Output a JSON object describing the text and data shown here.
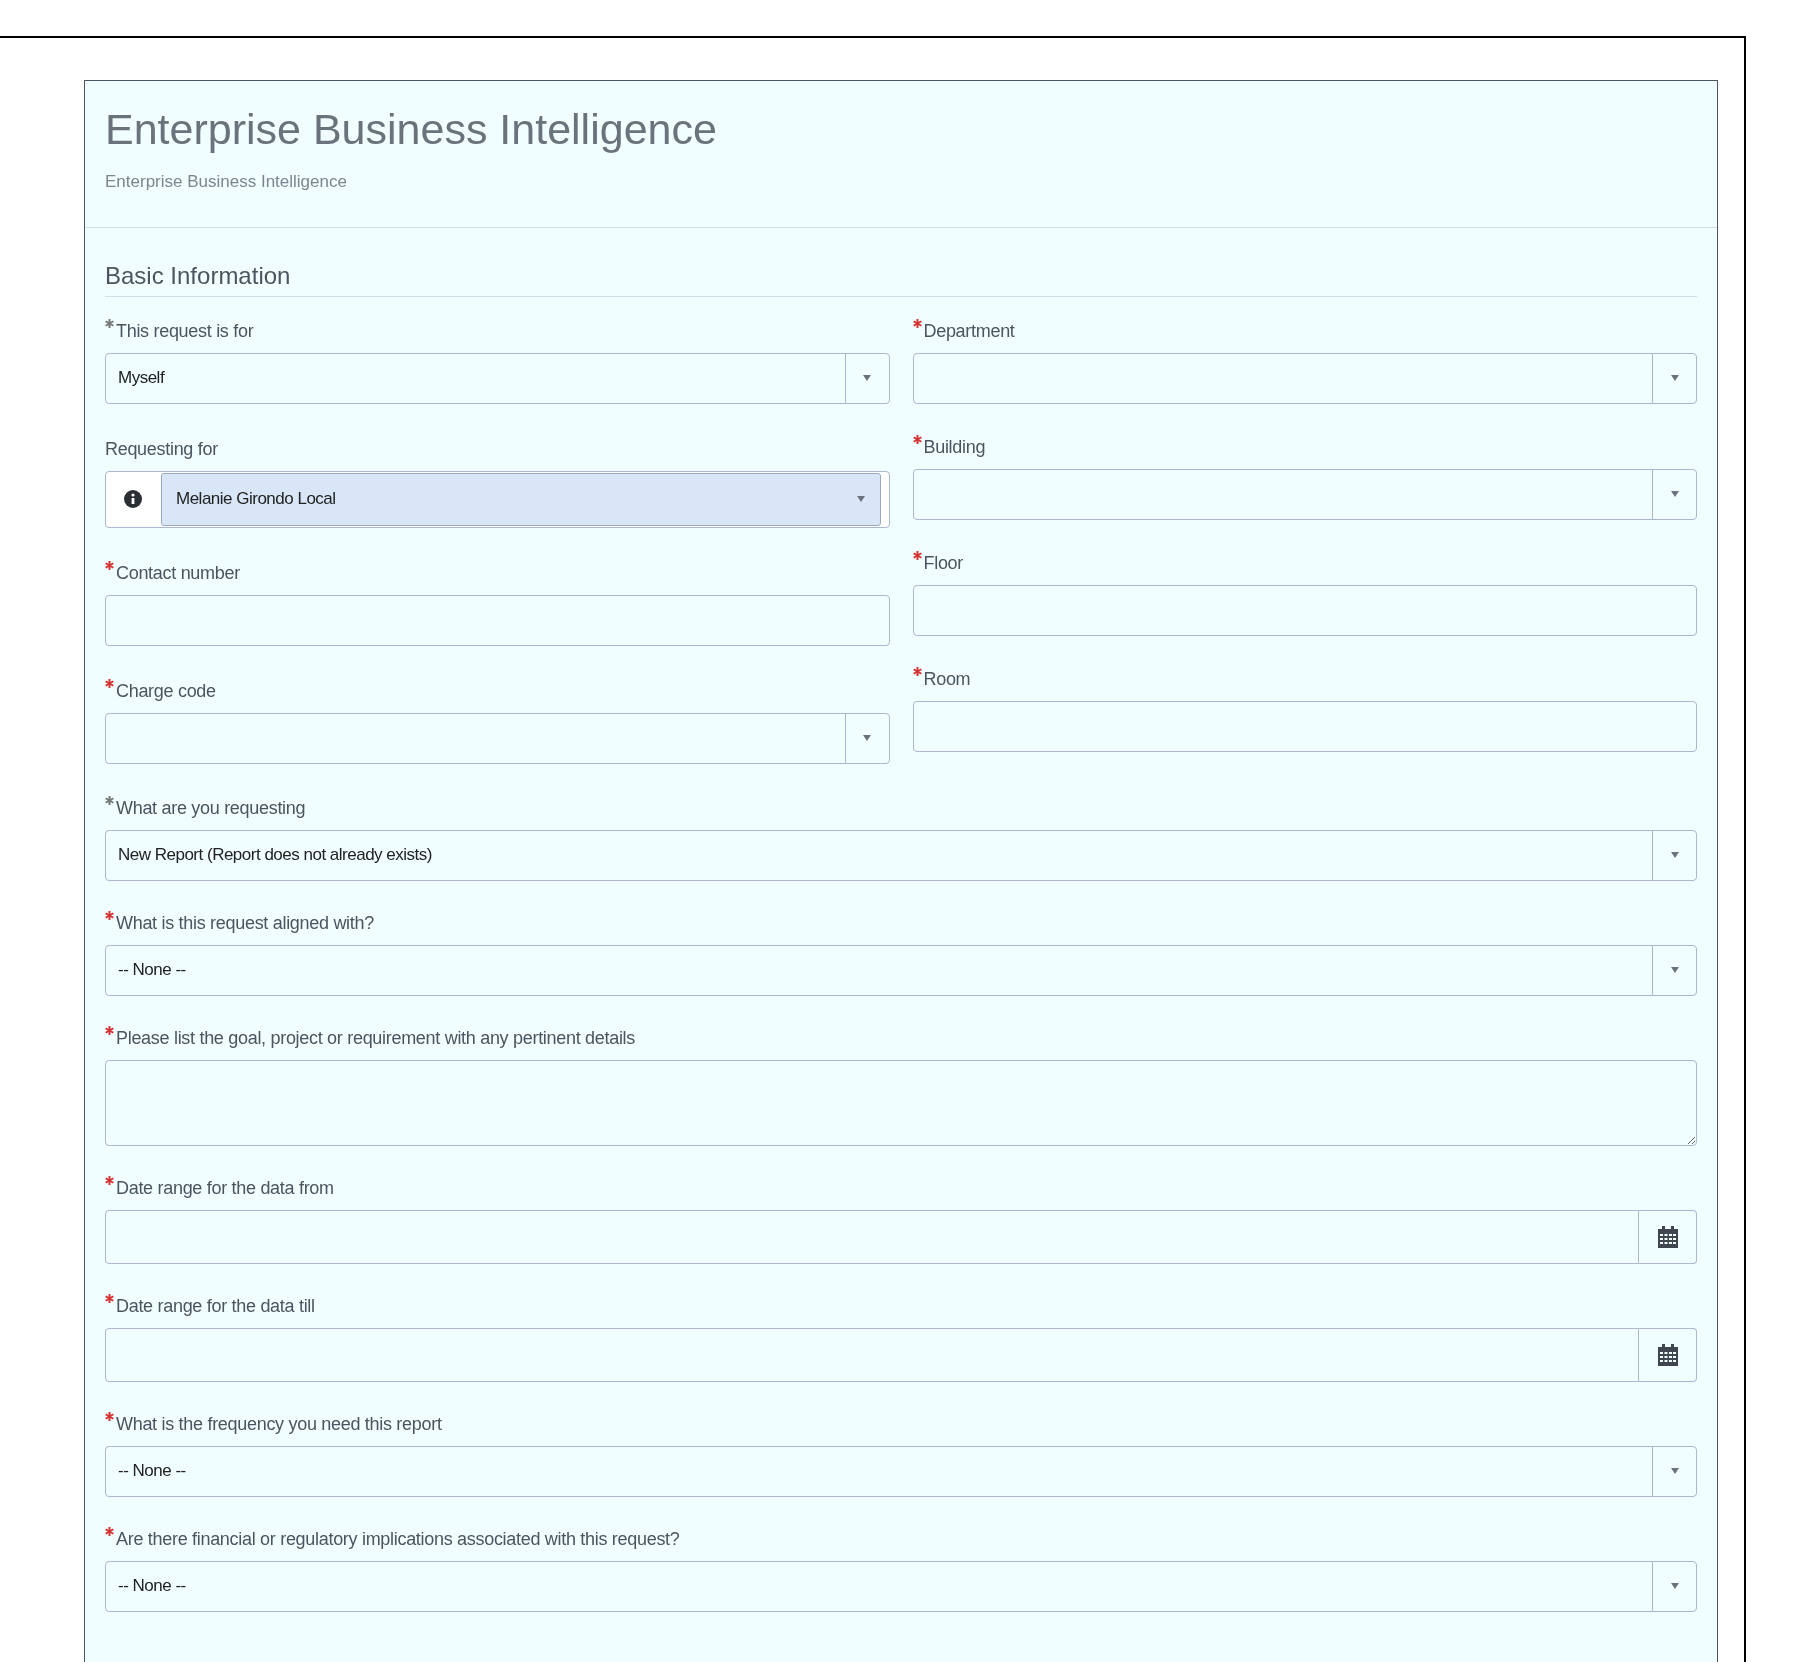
{
  "header": {
    "title": "Enterprise Business Intelligence",
    "subtitle": "Enterprise Business Intelligence"
  },
  "section": {
    "title": "Basic Information"
  },
  "left_fields": [
    {
      "label": "This request is for",
      "required": true,
      "filled": true,
      "kind": "select",
      "value": "Myself"
    },
    {
      "label": "Requesting for",
      "required": false,
      "kind": "reference",
      "value": "Melanie Girondo Local"
    },
    {
      "label": "Contact number",
      "required": true,
      "filled": false,
      "kind": "text"
    },
    {
      "label": "Charge code",
      "required": true,
      "filled": false,
      "kind": "select"
    }
  ],
  "right_fields": [
    {
      "label": "Department",
      "required": true,
      "filled": false,
      "kind": "select"
    },
    {
      "label": "Building",
      "required": true,
      "filled": false,
      "kind": "select"
    },
    {
      "label": "Floor",
      "required": true,
      "filled": false,
      "kind": "text"
    },
    {
      "label": "Room",
      "required": true,
      "filled": false,
      "kind": "text"
    }
  ],
  "wide_fields": [
    {
      "label": "What are you requesting",
      "required": true,
      "filled": true,
      "kind": "select",
      "value": "New Report (Report does not already exists)"
    },
    {
      "label": "What is this request aligned with?",
      "required": true,
      "filled": false,
      "kind": "select",
      "value": "-- None --"
    },
    {
      "label": "Please list the goal, project or requirement with any pertinent details",
      "required": true,
      "filled": false,
      "kind": "textarea"
    },
    {
      "label": "Date range for the data from",
      "required": true,
      "filled": false,
      "kind": "date"
    },
    {
      "label": "Date range for the data till",
      "required": true,
      "filled": false,
      "kind": "date"
    },
    {
      "label": "What is the frequency you need this report",
      "required": true,
      "filled": false,
      "kind": "select",
      "value": "-- None --"
    },
    {
      "label": "Are there financial or regulatory implications associated with this request?",
      "required": true,
      "filled": false,
      "kind": "select",
      "value": "-- None --"
    }
  ]
}
